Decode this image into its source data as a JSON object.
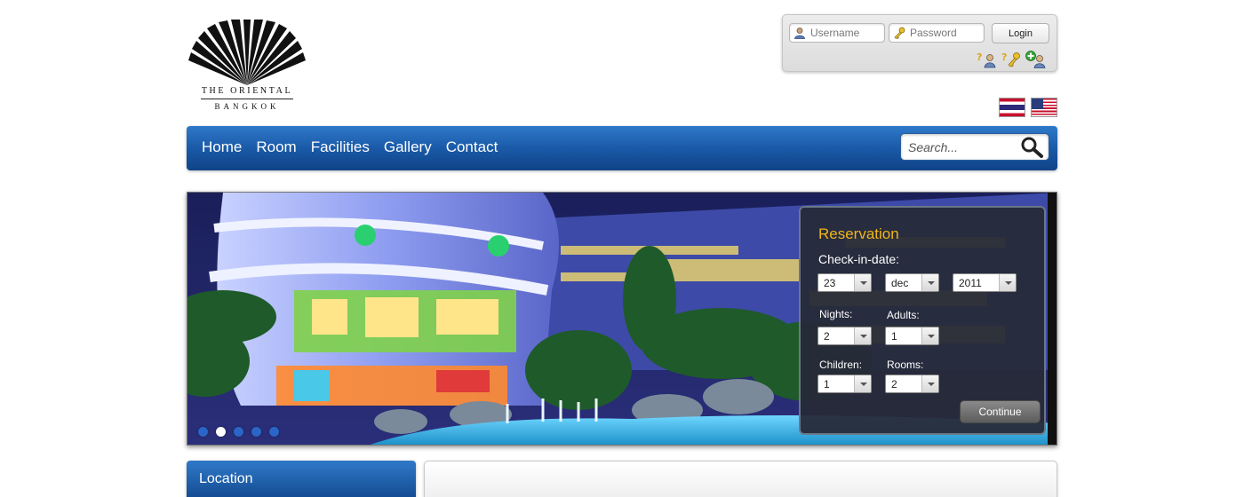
{
  "brand": {
    "line1": "THE ORIENTAL",
    "line2": "BANGKOK"
  },
  "login": {
    "username_placeholder": "Username",
    "password_placeholder": "Password",
    "login_label": "Login",
    "icons": [
      "forgot-username-icon",
      "forgot-password-icon",
      "register-icon"
    ]
  },
  "languages": [
    {
      "name": "thai-flag-icon"
    },
    {
      "name": "us-flag-icon"
    }
  ],
  "nav": {
    "items": [
      "Home",
      "Room",
      "Facilities",
      "Gallery",
      "Contact"
    ],
    "search_placeholder": "Search..."
  },
  "slider": {
    "slide_count": 5,
    "active_slide": 2
  },
  "reservation": {
    "title": "Reservation",
    "checkin_label": "Check-in-date:",
    "day": "23",
    "month": "dec",
    "year": "2011",
    "nights_label": "Nights:",
    "nights": "2",
    "adults_label": "Adults:",
    "adults": "1",
    "children_label": "Children:",
    "children": "1",
    "rooms_label": "Rooms:",
    "rooms": "2",
    "continue_label": "Continue"
  },
  "location": {
    "title": "Location"
  },
  "colors": {
    "nav_blue": "#1a5aa8",
    "reservation_title": "#f2b518",
    "panel_bg": "#262a38"
  }
}
